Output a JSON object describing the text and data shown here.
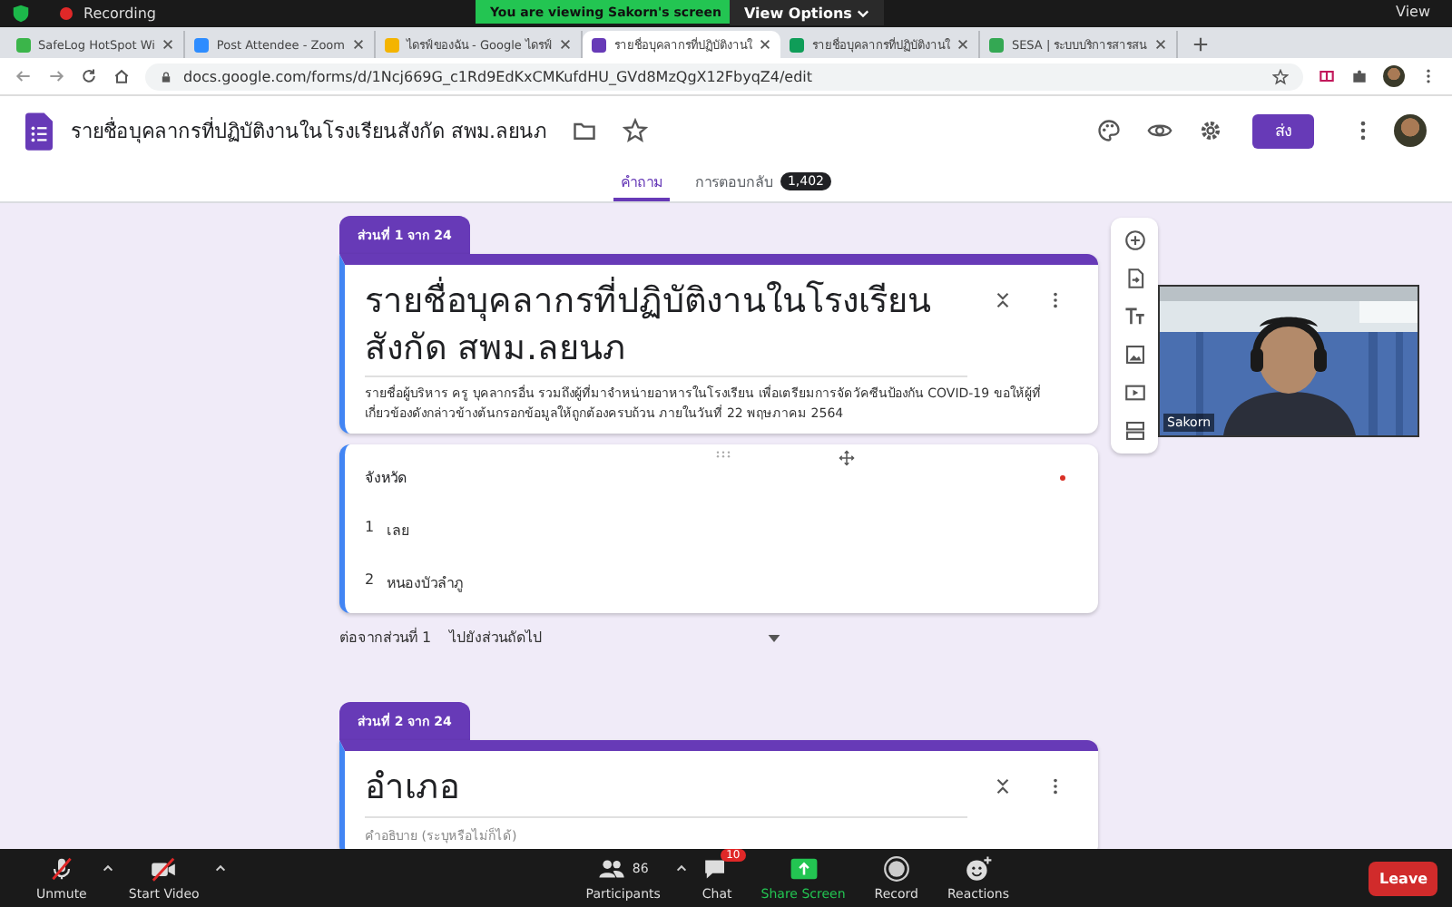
{
  "meeting": {
    "recording_label": "Recording",
    "banner": "You are viewing Sakorn's screen",
    "view_options": "View Options",
    "view": "View"
  },
  "browser": {
    "tabs": [
      {
        "label": "SafeLog HotSpot Wi",
        "kind": "safelog",
        "selected": false
      },
      {
        "label": "Post Attendee - Zoom",
        "kind": "zoom",
        "selected": false
      },
      {
        "label": "ไดรฟ์ของฉัน - Google ไดรฟ์",
        "kind": "drive",
        "selected": false
      },
      {
        "label": "รายชื่อบุคลากรที่ปฏิบัติงานใ",
        "kind": "forms",
        "selected": true
      },
      {
        "label": "รายชื่อบุคลากรที่ปฏิบัติงานใ",
        "kind": "sheets",
        "selected": false
      },
      {
        "label": "SESA | ระบบบริการสารสน",
        "kind": "chart",
        "selected": false
      }
    ],
    "url": "docs.google.com/forms/d/1Ncj669G_c1Rd9EdKxCMKufdHU_GVd8MzQgX12FbyqZ4/edit"
  },
  "form": {
    "title": "รายชื่อบุคลากรที่ปฏิบัติงานในโรงเรียนสังกัด สพม.ลยนภ",
    "send_button": "ส่ง",
    "tabs": [
      {
        "label": "คำถาม",
        "selected": true
      },
      {
        "label": "การตอบกลับ",
        "selected": false,
        "count": "1,402"
      }
    ],
    "sections": [
      {
        "tag": "ส่วนที่ 1 จาก 24",
        "title": "รายชื่อบุคลากรที่ปฏิบัติงานในโรงเรียนสังกัด สพม.ลยนภ",
        "description": "รายชื่อผู้บริหาร ครู บุคลากรอื่น รวมถึงผู้ที่มาจำหน่ายอาหารในโรงเรียน เพื่อเตรียมการจัดวัคซีนป้องกัน COVID-19 ขอให้ผู้ที่เกี่ยวข้องดังกล่าวข้างต้นกรอกข้อมูลให้ถูกต้องครบถ้วน ภายในวันที่ 22 พฤษภาคม 2564",
        "question": {
          "title": "จังหวัด",
          "options": [
            {
              "number": "1",
              "label": "เลย"
            },
            {
              "number": "2",
              "label": "หนองบัวลำภู"
            }
          ]
        },
        "after": {
          "label": "ต่อจากส่วนที่ 1",
          "value": "ไปยังส่วนถัดไป"
        }
      },
      {
        "tag": "ส่วนที่ 2 จาก 24",
        "title": "อำเภอ",
        "placeholder": "คำอธิบาย (ระบุหรือไม่ก็ได้)"
      }
    ]
  },
  "video": {
    "name": "Sakorn"
  },
  "toolbar": {
    "items": [
      {
        "kind": "unmute",
        "label": "Unmute"
      },
      {
        "kind": "video",
        "label": "Start Video"
      },
      {
        "kind": "participants",
        "label": "Participants",
        "count": "86"
      },
      {
        "kind": "chat",
        "label": "Chat",
        "badge": "10"
      },
      {
        "kind": "share",
        "label": "Share Screen"
      },
      {
        "kind": "record",
        "label": "Record"
      },
      {
        "kind": "reactions",
        "label": "Reactions"
      }
    ],
    "leave": "Leave"
  }
}
